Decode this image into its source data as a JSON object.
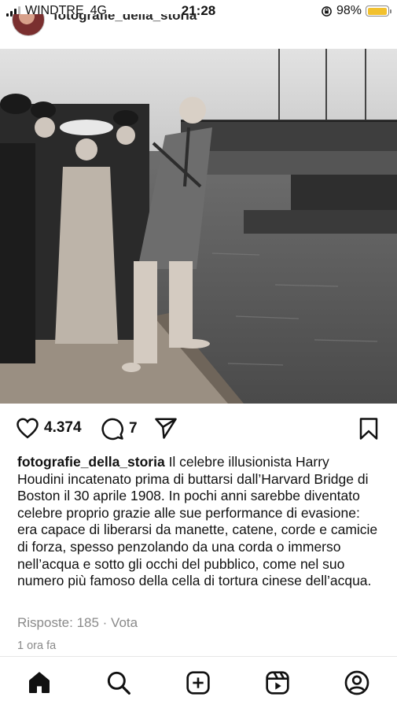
{
  "status_bar": {
    "carrier": "WINDTRE",
    "network": "4G",
    "time": "21:28",
    "battery_percent": "98%",
    "battery_level": 0.98,
    "battery_color": "#f2c12e"
  },
  "post": {
    "username": "fotografie_della_storia",
    "likes": "4.374",
    "comments": "7",
    "caption_user": "fotografie_della_storia",
    "caption_text": " Il celebre illusionista Harry Houdini incatenato prima di buttarsi dall’Harvard Bridge di Boston il 30 aprile 1908. In pochi anni sarebbe diventato celebre proprio grazie alle sue performance di evasione: era capace di liberarsi da manette, catene, corde e camicie di forza, spesso penzolando da una corda o immerso nell’acqua e sotto gli occhi del pubblico, come nel suo numero più famoso della cella di tortura cinese dell’acqua.",
    "replies_label": "Risposte: 185 · Vota",
    "time_ago": "1 ora fa"
  },
  "icons": {
    "like": "heart-icon",
    "comment": "comment-icon",
    "share": "send-icon",
    "save": "bookmark-icon",
    "nav": [
      "home-icon",
      "search-icon",
      "create-icon",
      "reels-icon",
      "profile-icon"
    ]
  }
}
